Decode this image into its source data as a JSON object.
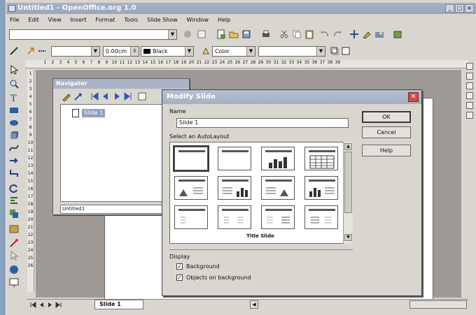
{
  "window": {
    "title": "Untitled1 - OpenOffice.org 1.0",
    "controls": [
      "_",
      "□",
      "×"
    ]
  },
  "menu": [
    "File",
    "Edit",
    "View",
    "Insert",
    "Format",
    "Tools",
    "Slide Show",
    "Window",
    "Help"
  ],
  "toolbar": {
    "line_width": "0.00cm",
    "line_color": "Black",
    "fill_type": "Color"
  },
  "navigator": {
    "title": "Navigator",
    "tree_item": "Slide 1",
    "footer": "Untitled1"
  },
  "dialog": {
    "title": "Modify Slide",
    "name_label": "Name",
    "name_value": "Slide 1",
    "layout_label": "Select an AutoLayout",
    "selected_layout": "Title Slide",
    "display_label": "Display",
    "checkboxes": [
      {
        "label": "Background",
        "checked": true
      },
      {
        "label": "Objects on background",
        "checked": true
      }
    ],
    "buttons": {
      "ok": "OK",
      "cancel": "Cancel",
      "help": "Help"
    }
  },
  "ruler_h_numbers": [
    "1",
    "2",
    "3",
    "4",
    "5",
    "6",
    "7",
    "8",
    "9",
    "10",
    "11",
    "12",
    "13",
    "14",
    "15",
    "16",
    "17",
    "18",
    "19",
    "20",
    "21",
    "22",
    "23",
    "24",
    "25",
    "26",
    "27",
    "28",
    "29",
    "30",
    "31",
    "32",
    "33",
    "34",
    "35",
    "36",
    "37",
    "38",
    "39"
  ],
  "ruler_v_numbers": [
    "1",
    "2",
    "3",
    "4",
    "5",
    "6",
    "7",
    "8",
    "9",
    "10",
    "11",
    "12",
    "13",
    "14",
    "15",
    "16",
    "17",
    "18",
    "19",
    "20",
    "21",
    "22",
    "23",
    "24",
    "25",
    "26"
  ],
  "status": {
    "slide_tab": "Slide 1"
  }
}
